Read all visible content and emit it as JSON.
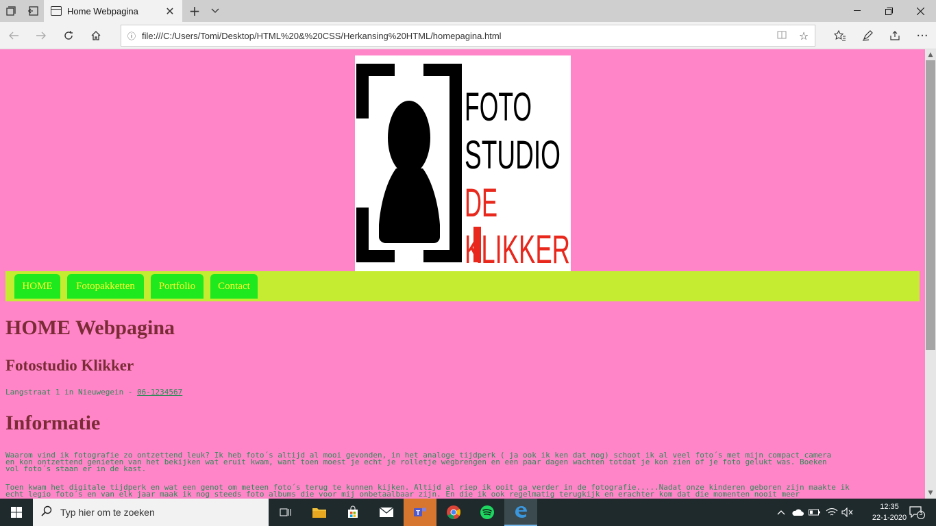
{
  "browser": {
    "tab_title": "Home Webpagina",
    "url": "file:///C:/Users/Tomi/Desktop/HTML%20&%20CSS/Herkansing%20HTML/homepagina.html",
    "tab_icons": [
      "tab-sets-icon",
      "set-aside-icon"
    ],
    "nav_icons": [
      "back-icon",
      "forward-icon",
      "refresh-icon",
      "home-icon"
    ]
  },
  "page": {
    "logo": {
      "line1": "FOTO",
      "line2": "STUDIO",
      "line3": "DE",
      "line4": "KLIKKER",
      "colors": {
        "red": "#e8281c",
        "green": "#8cc63f",
        "black": "#000000"
      }
    },
    "menu": [
      "HOME",
      "Fotopakketten",
      "Portfolio",
      "Contact"
    ],
    "heading": "HOME Webpagina",
    "subheading": "Fotostudio Klikker",
    "address_text": "Langstraat 1 in Nieuwegein - ",
    "phone": "06-1234567",
    "info_heading": "Informatie",
    "para1_l1": "Waarom vind ik fotografie zo ontzettend leuk? Ik heb foto´s altijd al mooi gevonden, in het analoge tijdperk ( ja ook ik ken dat nog) schoot ik al veel foto´s met mijn compact camera",
    "para1_l2": "en kon ontzettend genieten van het bekijken wat eruit kwam, want toen moest je echt je rolletje wegbrengen en een paar dagen wachten totdat je kon zien of je foto gelukt was. Boeken",
    "para1_l3": "vol foto´s staan er in de kast.",
    "para2_l1": "Toen kwam het digitale tijdperk en wat een genot om meteen foto´s terug te kunnen kijken. Altijd al riep ik ooit ga verder in de fotografie.....Nadat onze kinderen geboren zijn maakte ik",
    "para2_l2": "echt legio foto´s en van elk jaar maak ik nog steeds foto albums die voor mij onbetaalbaar zijn. En die ik ook regelmatig terugkijk en erachter kom dat die momenten nooit meer"
  },
  "colors": {
    "page_bg": "#ff85c8",
    "menu_bg": "#c6ec31",
    "menu_item": "#1ee81e",
    "menu_text": "#ffff2e",
    "heading": "#7a2b35",
    "text": "#2e8b57"
  },
  "taskbar": {
    "search_placeholder": "Typ hier om te zoeken",
    "time": "12:35",
    "date": "22-1-2020",
    "notifications": "3",
    "apps": [
      "task-view-icon",
      "file-explorer-icon",
      "store-icon",
      "mail-icon",
      "teams-icon",
      "chrome-icon",
      "spotify-icon",
      "edge-icon"
    ]
  }
}
